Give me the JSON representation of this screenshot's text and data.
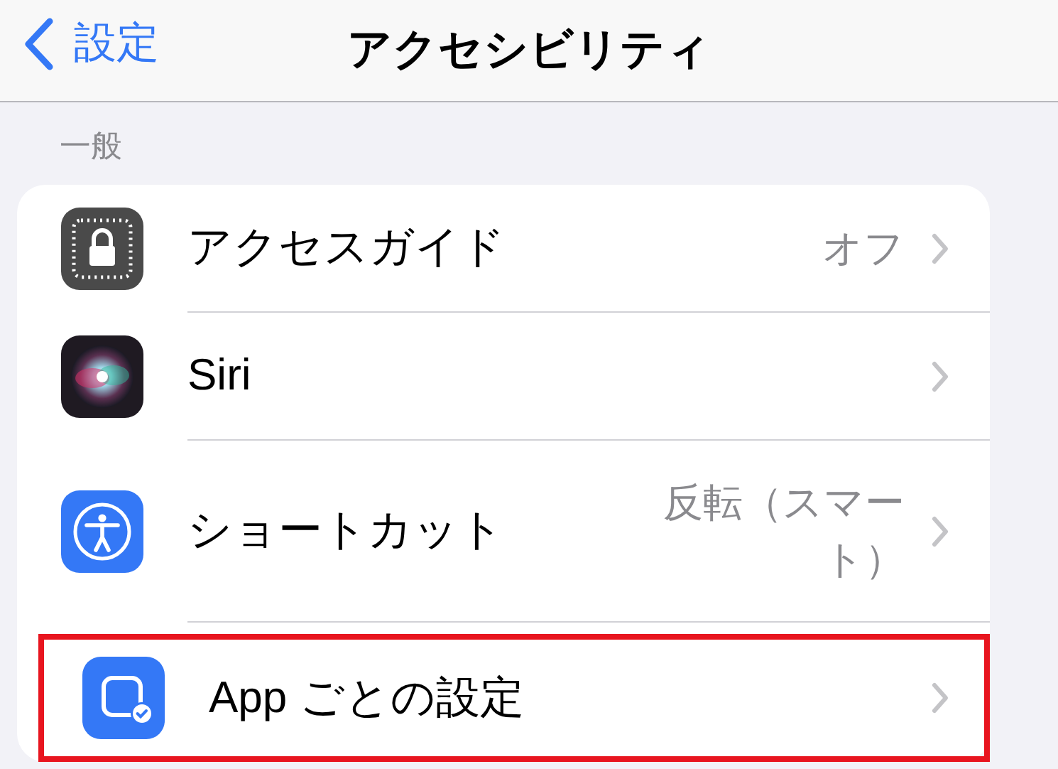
{
  "nav": {
    "back_label": "設定",
    "title": "アクセシビリティ"
  },
  "section": {
    "header": "一般",
    "items": [
      {
        "kind": "lock",
        "label": "アクセスガイド",
        "value": "オフ",
        "highlighted": false
      },
      {
        "kind": "siri",
        "label": "Siri",
        "highlighted": false
      },
      {
        "kind": "accessibility",
        "label": "ショートカット",
        "value": "反転（スマート）",
        "highlighted": false
      },
      {
        "kind": "app",
        "label": "App ごとの設定",
        "highlighted": true
      }
    ]
  }
}
